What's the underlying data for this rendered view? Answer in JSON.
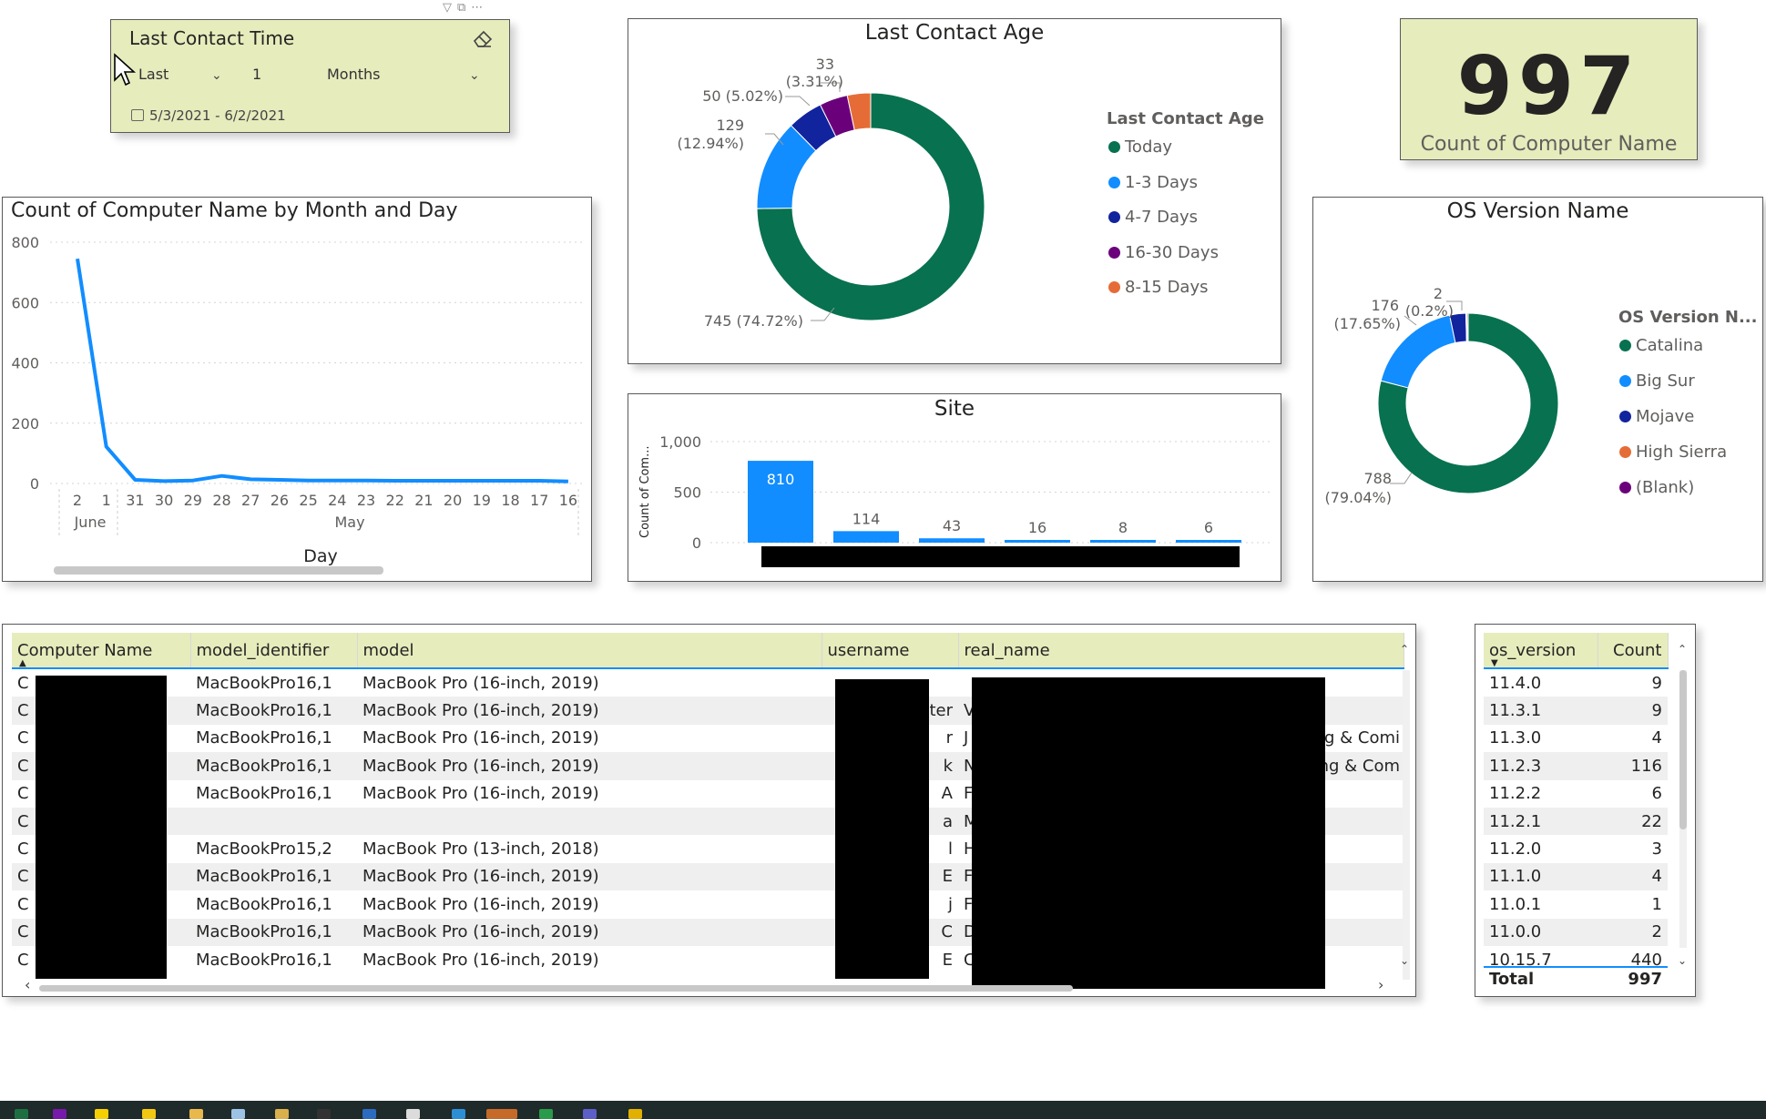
{
  "slicer": {
    "title": "Last Contact Time",
    "relative": "Last",
    "count": "1",
    "unit": "Months",
    "date_range": "5/3/2021 - 6/2/2021"
  },
  "line_chart": {
    "title": "Count of Computer Name by Month and Day",
    "x_title": "Day",
    "month_june": "June",
    "month_may": "May"
  },
  "contact_age": {
    "title": "Last Contact Age",
    "legend_title": "Last Contact Age",
    "labels": {
      "l33": "33",
      "l33pct": "(3.31%)",
      "l50": "50 (5.02%)",
      "l129": "129",
      "l129pct": "(12.94%)",
      "l745": "745 (74.72%)"
    }
  },
  "kpi": {
    "value": "997",
    "label": "Count of Computer Name"
  },
  "site": {
    "title": "Site",
    "ylabel": "Count of Com..."
  },
  "os": {
    "title": "OS Version Name",
    "legend_title": "OS Version N...",
    "labels": {
      "l2": "2",
      "l2pct": "(0.2%)",
      "l176": "176",
      "l176pct": "(17.65%)",
      "l788": "788",
      "l788pct": "(79.04%)"
    }
  },
  "chart_data": [
    {
      "type": "line",
      "title": "Count of Computer Name by Month and Day",
      "xlabel": "Day",
      "x": [
        "2",
        "1",
        "31",
        "30",
        "29",
        "28",
        "27",
        "26",
        "25",
        "24",
        "23",
        "22",
        "21",
        "20",
        "19",
        "18",
        "17",
        "16"
      ],
      "month_groups": [
        {
          "label": "June",
          "days": [
            "2",
            "1"
          ]
        },
        {
          "label": "May",
          "days": [
            "31",
            "30",
            "29",
            "28",
            "27",
            "26",
            "25",
            "24",
            "23",
            "22",
            "21",
            "20",
            "19",
            "18",
            "17",
            "16"
          ]
        }
      ],
      "values": [
        745,
        122,
        12,
        8,
        10,
        25,
        14,
        12,
        10,
        10,
        10,
        9,
        9,
        9,
        9,
        9,
        9,
        7
      ],
      "ylim": [
        0,
        800
      ],
      "yticks": [
        0,
        200,
        400,
        600,
        800
      ],
      "color": "#118dff",
      "grid": true
    },
    {
      "type": "pie",
      "title": "Last Contact Age",
      "categories": [
        "Today",
        "1-3 Days",
        "4-7 Days",
        "16-30 Days",
        "8-15 Days"
      ],
      "values": [
        745,
        129,
        50,
        40,
        33
      ],
      "colors": [
        "#077150",
        "#118dff",
        "#12239e",
        "#6b007b",
        "#e66c37"
      ],
      "legend": "right"
    },
    {
      "type": "bar",
      "title": "Site",
      "ylabel": "Count of Com...",
      "values": [
        810,
        114,
        43,
        16,
        8,
        6
      ],
      "value_labels": [
        "810",
        "114",
        "43",
        "16",
        "8",
        "6"
      ],
      "ylim": [
        0,
        1000
      ],
      "yticks": [
        0,
        500,
        1000
      ],
      "ytick_labels": [
        "0",
        "500",
        "1,000"
      ],
      "color": "#118dff"
    },
    {
      "type": "pie",
      "title": "OS Version Name",
      "categories": [
        "Catalina",
        "Big Sur",
        "Mojave",
        "High Sierra",
        "(Blank)"
      ],
      "values": [
        788,
        176,
        29,
        2,
        2
      ],
      "colors": [
        "#077150",
        "#118dff",
        "#12239e",
        "#e66c37",
        "#6b007b"
      ],
      "legend": "right"
    }
  ],
  "computers_table": {
    "columns": [
      "Computer Name",
      "model_identifier",
      "model",
      "username",
      "real_name"
    ],
    "rows": [
      {
        "name": "C",
        "id": "MacBookPro16,1",
        "model": "MacBook Pro (16-inch, 2019)",
        "user": "",
        "real": ""
      },
      {
        "name": "C",
        "id": "MacBookPro16,1",
        "model": "MacBook Pro (16-inch, 2019)",
        "user": "ter",
        "real": "V"
      },
      {
        "name": "C",
        "id": "MacBookPro16,1",
        "model": "MacBook Pro (16-inch, 2019)",
        "user": "r",
        "real": "J",
        "tail": "g & Comi"
      },
      {
        "name": "C",
        "id": "MacBookPro16,1",
        "model": "MacBook Pro (16-inch, 2019)",
        "user": "k",
        "real": "N",
        "tail": "ng & Com"
      },
      {
        "name": "C",
        "id": "MacBookPro16,1",
        "model": "MacBook Pro (16-inch, 2019)",
        "user": "A",
        "real": "F"
      },
      {
        "name": "C",
        "id": "",
        "model": "",
        "user": "a",
        "real": "M"
      },
      {
        "name": "C",
        "id": "MacBookPro15,2",
        "model": "MacBook Pro (13-inch, 2018)",
        "user": "l",
        "real": "H"
      },
      {
        "name": "C",
        "id": "MacBookPro16,1",
        "model": "MacBook Pro (16-inch, 2019)",
        "user": "E",
        "real": "F"
      },
      {
        "name": "C",
        "id": "MacBookPro16,1",
        "model": "MacBook Pro (16-inch, 2019)",
        "user": "j",
        "real": "F"
      },
      {
        "name": "C",
        "id": "MacBookPro16,1",
        "model": "MacBook Pro (16-inch, 2019)",
        "user": "C",
        "real": "D"
      },
      {
        "name": "C",
        "id": "MacBookPro16,1",
        "model": "MacBook Pro (16-inch, 2019)",
        "user": "E",
        "real": "C"
      }
    ]
  },
  "os_table": {
    "columns": [
      "os_version",
      "Count"
    ],
    "rows": [
      {
        "v": "11.4.0",
        "c": "9"
      },
      {
        "v": "11.3.1",
        "c": "9"
      },
      {
        "v": "11.3.0",
        "c": "4"
      },
      {
        "v": "11.2.3",
        "c": "116"
      },
      {
        "v": "11.2.2",
        "c": "6"
      },
      {
        "v": "11.2.1",
        "c": "22"
      },
      {
        "v": "11.2.0",
        "c": "3"
      },
      {
        "v": "11.1.0",
        "c": "4"
      },
      {
        "v": "11.0.1",
        "c": "1"
      },
      {
        "v": "11.0.0",
        "c": "2"
      },
      {
        "v": "10.15.7",
        "c": "440"
      }
    ],
    "total_label": "Total",
    "total_value": "997"
  }
}
